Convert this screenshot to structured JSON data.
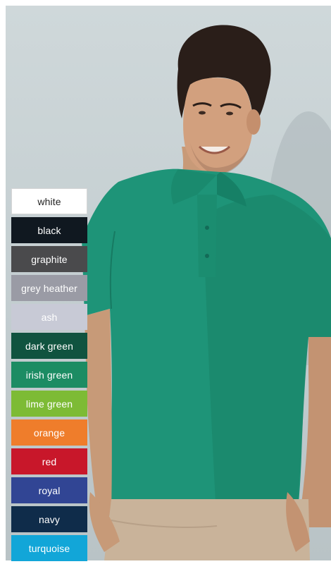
{
  "swatches": [
    {
      "label": "white",
      "bg": "#ffffff",
      "fg": "#222222"
    },
    {
      "label": "black",
      "bg": "#101820",
      "fg": "#ffffff"
    },
    {
      "label": "graphite",
      "bg": "#4a4a4c",
      "fg": "#ffffff"
    },
    {
      "label": "grey heather",
      "bg": "#9a9ba5",
      "fg": "#ffffff"
    },
    {
      "label": "ash",
      "bg": "#c8cad6",
      "fg": "#ffffff"
    },
    {
      "label": "dark green",
      "bg": "#10533f",
      "fg": "#ffffff"
    },
    {
      "label": "irish green",
      "bg": "#1c8c63",
      "fg": "#ffffff"
    },
    {
      "label": "lime green",
      "bg": "#7dbb35",
      "fg": "#ffffff"
    },
    {
      "label": "orange",
      "bg": "#ef7d2b",
      "fg": "#ffffff"
    },
    {
      "label": "red",
      "bg": "#c8172a",
      "fg": "#ffffff"
    },
    {
      "label": "royal",
      "bg": "#314594",
      "fg": "#ffffff"
    },
    {
      "label": "navy",
      "bg": "#0f2c4a",
      "fg": "#ffffff"
    },
    {
      "label": "turquoise",
      "bg": "#12a6d8",
      "fg": "#ffffff"
    }
  ],
  "photo": {
    "subject": "model-in-teal-polo",
    "shirt_color": "#1e9478",
    "background_color": "#c7d0d3",
    "pants_color": "#c9b39a"
  }
}
